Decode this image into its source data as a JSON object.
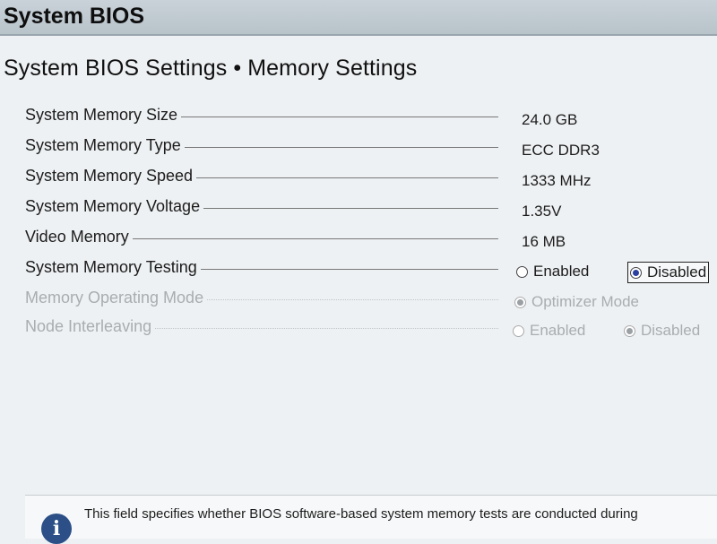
{
  "header": {
    "title": "System BIOS"
  },
  "page": {
    "title": "System BIOS Settings • Memory Settings"
  },
  "settings": [
    {
      "label": "System Memory Size",
      "value": "24.0 GB"
    },
    {
      "label": "System Memory Type",
      "value": "ECC DDR3"
    },
    {
      "label": "System Memory Speed",
      "value": "1333 MHz"
    },
    {
      "label": "System Memory Voltage",
      "value": "1.35V"
    },
    {
      "label": "Video Memory",
      "value": "16 MB"
    },
    {
      "label": "System Memory Testing",
      "options": [
        "Enabled",
        "Disabled"
      ],
      "selected": "Disabled"
    },
    {
      "label": "Memory Operating Mode",
      "options": [
        "Optimizer Mode"
      ],
      "selected": "Optimizer Mode",
      "disabled": true
    },
    {
      "label": "Node Interleaving",
      "options": [
        "Enabled",
        "Disabled"
      ],
      "selected": "Disabled",
      "disabled": true
    }
  ],
  "help": {
    "icon": "info-icon",
    "text": "This field specifies whether BIOS software-based system memory tests are conducted during"
  }
}
